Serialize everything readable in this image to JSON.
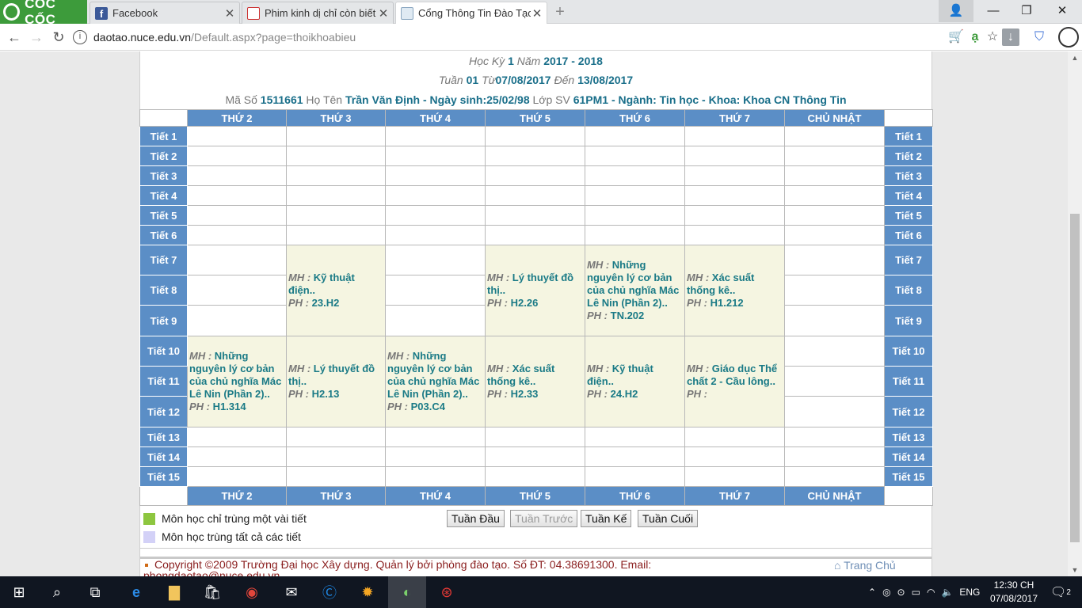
{
  "browser": {
    "brand": "CỐC CỐC",
    "tabs": [
      {
        "label": "Facebook",
        "icon": "facebook-icon"
      },
      {
        "label": "Phim kinh dị chỉ còn biết c",
        "icon": "news-icon"
      },
      {
        "label": "Cổng Thông Tin Đào Tạo-",
        "icon": "portal-icon"
      }
    ],
    "url_host": "daotao.nuce.edu.vn",
    "url_path": "/Default.aspx?page=thoikhoabieu"
  },
  "header": {
    "hoc_ky_label": "Học Kỳ",
    "hoc_ky": "1",
    "nam_label": "Năm",
    "nam": "2017 - 2018",
    "tuan_label": "Tuần",
    "tuan": "01",
    "tu_label": "Từ",
    "tu": "07/08/2017",
    "den_label": "Đến",
    "den": "13/08/2017",
    "ma_so_label": "Mã Số",
    "ma_so": "1511661",
    "ho_ten_label": "Họ Tên",
    "ho_ten": "Trần Văn Định - Ngày sinh:25/02/98",
    "lop_label": "Lớp SV",
    "lop": "61PM1 - Ngành: Tin học - Khoa: Khoa CN Thông Tin"
  },
  "days": [
    "THỨ 2",
    "THỨ 3",
    "THỨ 4",
    "THỨ 5",
    "THỨ 6",
    "THỨ 7",
    "CHỦ NHẬT"
  ],
  "periods": [
    "Tiết 1",
    "Tiết 2",
    "Tiết 3",
    "Tiết 4",
    "Tiết 5",
    "Tiết 6",
    "Tiết 7",
    "Tiết 8",
    "Tiết 9",
    "Tiết 10",
    "Tiết 11",
    "Tiết 12",
    "Tiết 13",
    "Tiết 14",
    "Tiết 15"
  ],
  "classes": {
    "mh_label": "MH :",
    "ph_label": "PH :",
    "t3_789": {
      "mh": "Kỹ thuật điện..",
      "ph": "23.H2"
    },
    "t5_789": {
      "mh": "Lý thuyết đồ thị..",
      "ph": "H2.26"
    },
    "t6_789": {
      "mh": "Những nguyên lý cơ bản của chủ nghĩa Mác Lê Nin (Phần 2)..",
      "ph": "TN.202"
    },
    "t7_789": {
      "mh": "Xác suất thống kê..",
      "ph": "H1.212"
    },
    "t2_101112": {
      "mh": "Những nguyên lý cơ bản của chủ nghĩa Mác Lê Nin (Phần 2)..",
      "ph": "H1.314"
    },
    "t3_101112": {
      "mh": "Lý thuyết đồ thị..",
      "ph": "H2.13"
    },
    "t4_101112": {
      "mh": "Những nguyên lý cơ bản của chủ nghĩa Mác Lê Nin (Phần 2)..",
      "ph": "P03.C4"
    },
    "t5_101112": {
      "mh": "Xác suất thống kê..",
      "ph": "H2.33"
    },
    "t6_101112": {
      "mh": "Kỹ thuật điện..",
      "ph": "24.H2"
    },
    "t7_101112": {
      "mh": "Giáo dục Thể chất 2 - Cầu lông..",
      "ph": ""
    }
  },
  "legend": {
    "partial": "Môn học chỉ trùng một vài tiết",
    "partial_color": "#8dc63f",
    "full": "Môn học trùng tất cả các tiết",
    "full_color": "#d3d1f7"
  },
  "pager": {
    "first": "Tuần Đầu",
    "prev": "Tuần Trước",
    "next": "Tuần Kế",
    "last": "Tuần Cuối"
  },
  "footer": {
    "text": "Copyright ©2009 Trường Đại học Xây dựng. Quản lý bởi phòng đào tạo. Số ĐT: 04.38691300. Email:",
    "email_partial": "phongdaotao@nuce.edu.vn",
    "home": "Trang Chủ"
  },
  "taskbar": {
    "lang": "ENG",
    "time": "12:30 CH",
    "date": "07/08/2017",
    "notifications": "2"
  },
  "colors": {
    "header_blue": "#5b8ec6",
    "class_bg": "#f5f5e1",
    "class_text": "#1a7a86",
    "brand_green": "#3d9b3b"
  }
}
